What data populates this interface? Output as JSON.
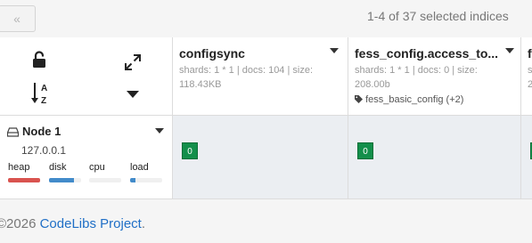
{
  "toolbar": {
    "prev_label": "«",
    "indices_summary": "1-4 of 37 selected indices"
  },
  "controls": {
    "icons": [
      "unlock-icon",
      "expand-icon",
      "sort-alpha-icon",
      "caret-down-icon"
    ]
  },
  "indices": [
    {
      "name": "configsync",
      "stats_line1": "shards: 1 * 1 | docs: 104 | size:",
      "stats_line2": "118.43KB",
      "alias": "",
      "shard_label": "0"
    },
    {
      "name": "fess_config.access_to...",
      "stats_line1": "shards: 1 * 1 | docs: 0 | size:",
      "stats_line2": "208.00b",
      "alias": "fess_basic_config (+2)",
      "shard_label": "0"
    },
    {
      "name": "f",
      "stats_line1": "s",
      "stats_line2": "2",
      "alias": "",
      "shard_label": ""
    }
  ],
  "node": {
    "name": "Node 1",
    "ip": "127.0.0.1",
    "metrics": [
      {
        "label": "heap",
        "percent": 100,
        "color": "#d9534f"
      },
      {
        "label": "disk",
        "percent": 78,
        "color": "#428bca"
      },
      {
        "label": "cpu",
        "percent": 0,
        "color": "#428bca"
      },
      {
        "label": "load",
        "percent": 18,
        "color": "#428bca"
      }
    ]
  },
  "footer": {
    "copyright": "©2026 ",
    "link_text": "CodeLibs Project",
    "suffix": "."
  }
}
